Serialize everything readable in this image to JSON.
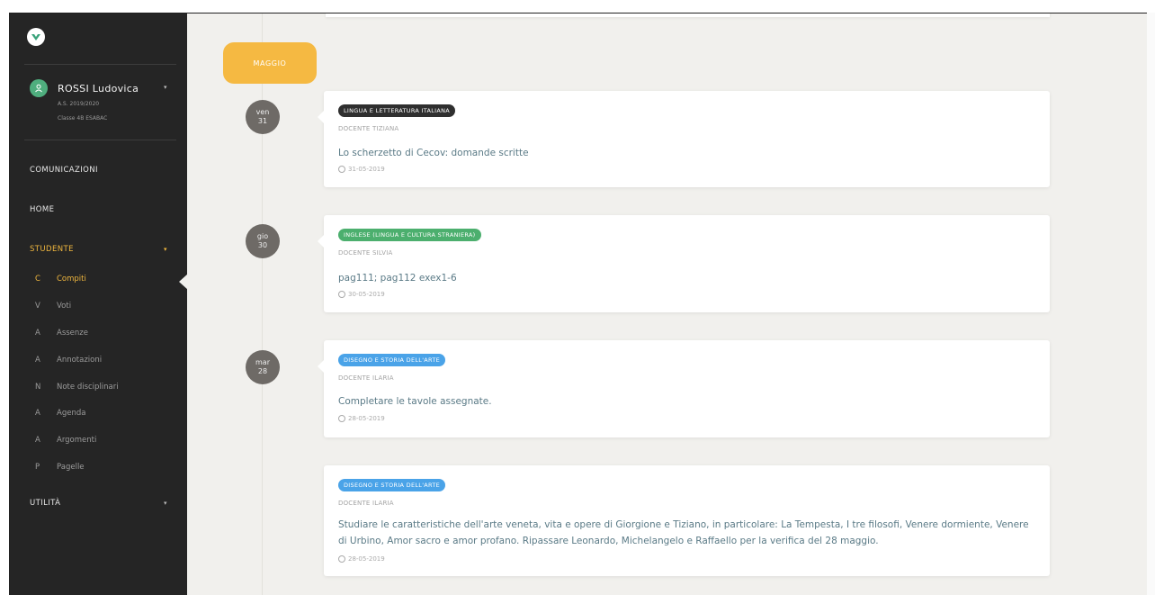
{
  "sidebar": {
    "user_name": "ROSSI Ludovica",
    "school_year": "A.S. 2019/2020",
    "class_label": "Classe 4B ESABAC",
    "nav": {
      "comunicazioni": "COMUNICAZIONI",
      "home": "HOME",
      "studente": "STUDENTE",
      "utilita": "UTILITÀ"
    },
    "sub_items": [
      {
        "letter": "C",
        "label": "Compiti"
      },
      {
        "letter": "V",
        "label": "Voti"
      },
      {
        "letter": "A",
        "label": "Assenze"
      },
      {
        "letter": "A",
        "label": "Annotazioni"
      },
      {
        "letter": "N",
        "label": "Note disciplinari"
      },
      {
        "letter": "A",
        "label": "Agenda"
      },
      {
        "letter": "A",
        "label": "Argomenti"
      },
      {
        "letter": "P",
        "label": "Pagelle"
      }
    ]
  },
  "timeline": {
    "month": "MAGGIO",
    "entries": [
      {
        "day_name": "ven",
        "day_num": "31",
        "tag": "LINGUA E LETTERATURA ITALIANA",
        "tag_color": "#2f2f2f",
        "teacher": "DOCENTE TIZIANA",
        "description": "Lo scherzetto di Cecov: domande scritte",
        "due": "31-05-2019"
      },
      {
        "day_name": "gio",
        "day_num": "30",
        "tag": "INGLESE (LINGUA E CULTURA STRANIERA)",
        "tag_color": "#4caf6e",
        "teacher": "DOCENTE SILVIA",
        "description": "pag111; pag112 exex1-6",
        "due": "30-05-2019"
      },
      {
        "day_name": "mar",
        "day_num": "28",
        "tag": "DISEGNO E STORIA DELL'ARTE",
        "tag_color": "#4aa3e8",
        "teacher": "DOCENTE ILARIA",
        "description": "Completare le tavole assegnate.",
        "due": "28-05-2019"
      },
      {
        "tag": "DISEGNO E STORIA DELL'ARTE",
        "tag_color": "#4aa3e8",
        "teacher": "DOCENTE ILARIA",
        "description": "Studiare le caratteristiche dell'arte veneta, vita e opere di Giorgione e Tiziano, in particolare: La Tempesta, I tre filosofi, Venere dormiente, Venere di Urbino, Amor sacro e amor profano. Ripassare Leonardo, Michelangelo e Raffaello per la verifica del 28 maggio.",
        "due": "28-05-2019"
      }
    ]
  },
  "colors": {
    "sidebar_bg": "#252525",
    "accent": "#f0b73e",
    "month_pill": "#f5b942",
    "avatar": "#4fae7e"
  }
}
